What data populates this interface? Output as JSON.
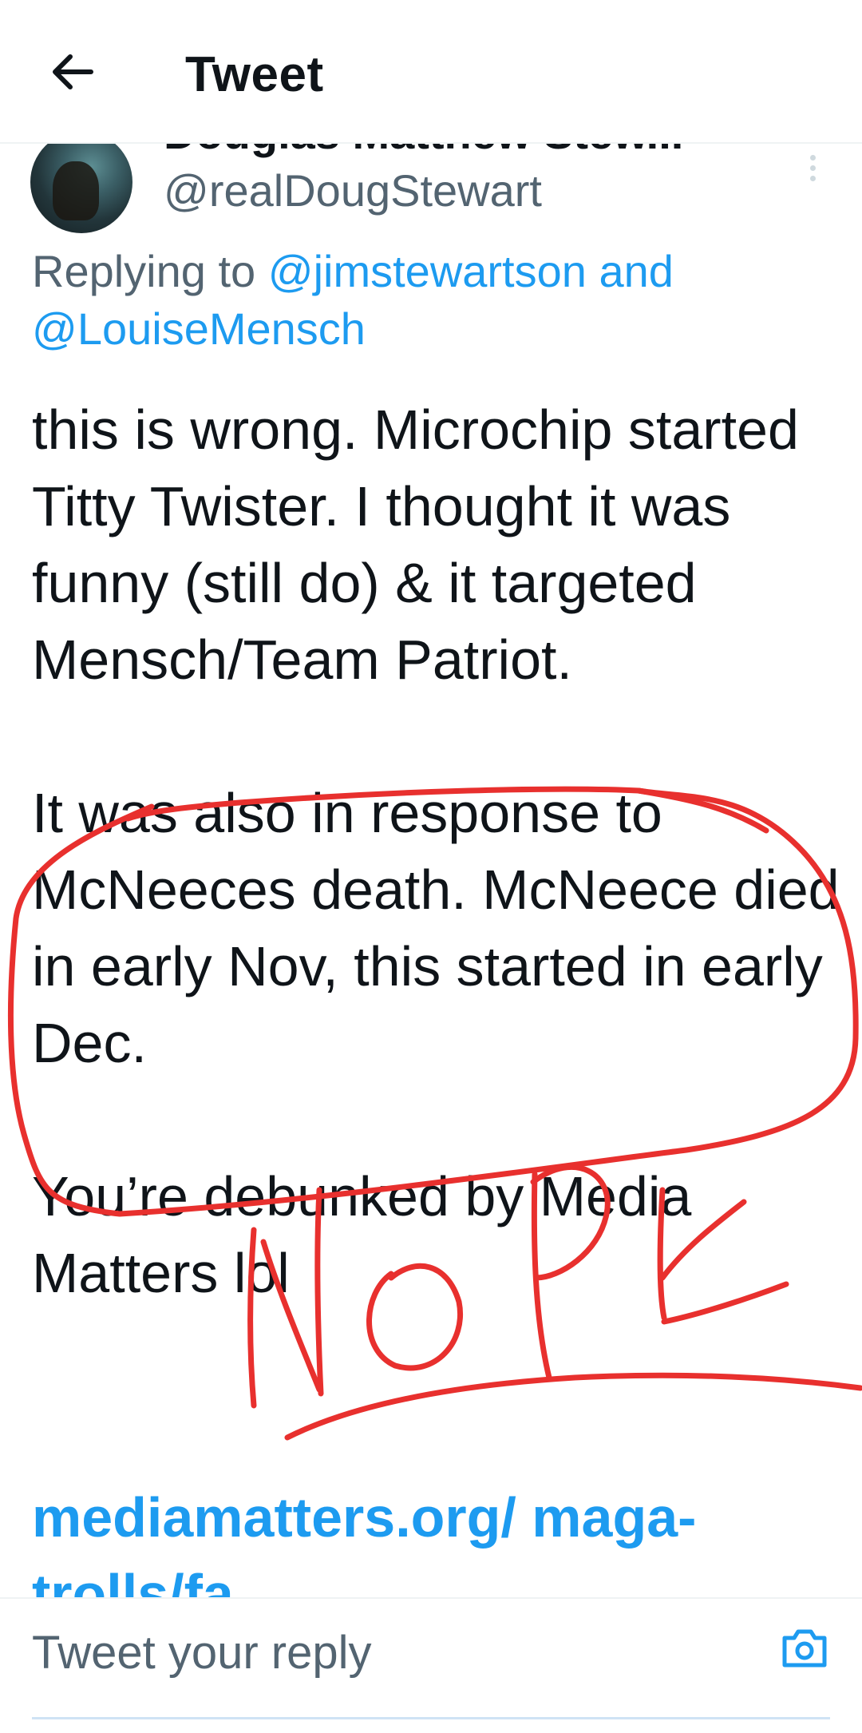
{
  "header": {
    "title": "Tweet",
    "back_icon": "arrow-left-icon"
  },
  "author": {
    "display_name": "Douglas Matthew Stew...",
    "handle": "@realDougStewart",
    "more_icon": "more-vertical-icon"
  },
  "replying_to": {
    "prefix": "Replying to ",
    "mention_1": "@jimstewartson and",
    "mention_2": "@LouiseMensch"
  },
  "tweet": {
    "paragraph_1": "this is wrong. Microchip started Titty Twister. I thought it was funny (still do) & it targeted Mensch/Team Patriot.",
    "paragraph_2": "It was also in response to McNeeces death. McNeece died in early Nov, this started in early Dec.",
    "paragraph_3": "You’re debunked by Media Matters lol",
    "link": "mediamatters.org/ maga-trolls/fa"
  },
  "reply_bar": {
    "placeholder": "Tweet your reply",
    "camera_icon": "camera-icon"
  },
  "annotation": {
    "handwritten_text": "NOPE",
    "color": "#e8302e"
  },
  "colors": {
    "accent": "#1d9bf0",
    "text": "#0f1419",
    "secondary": "#536471"
  }
}
